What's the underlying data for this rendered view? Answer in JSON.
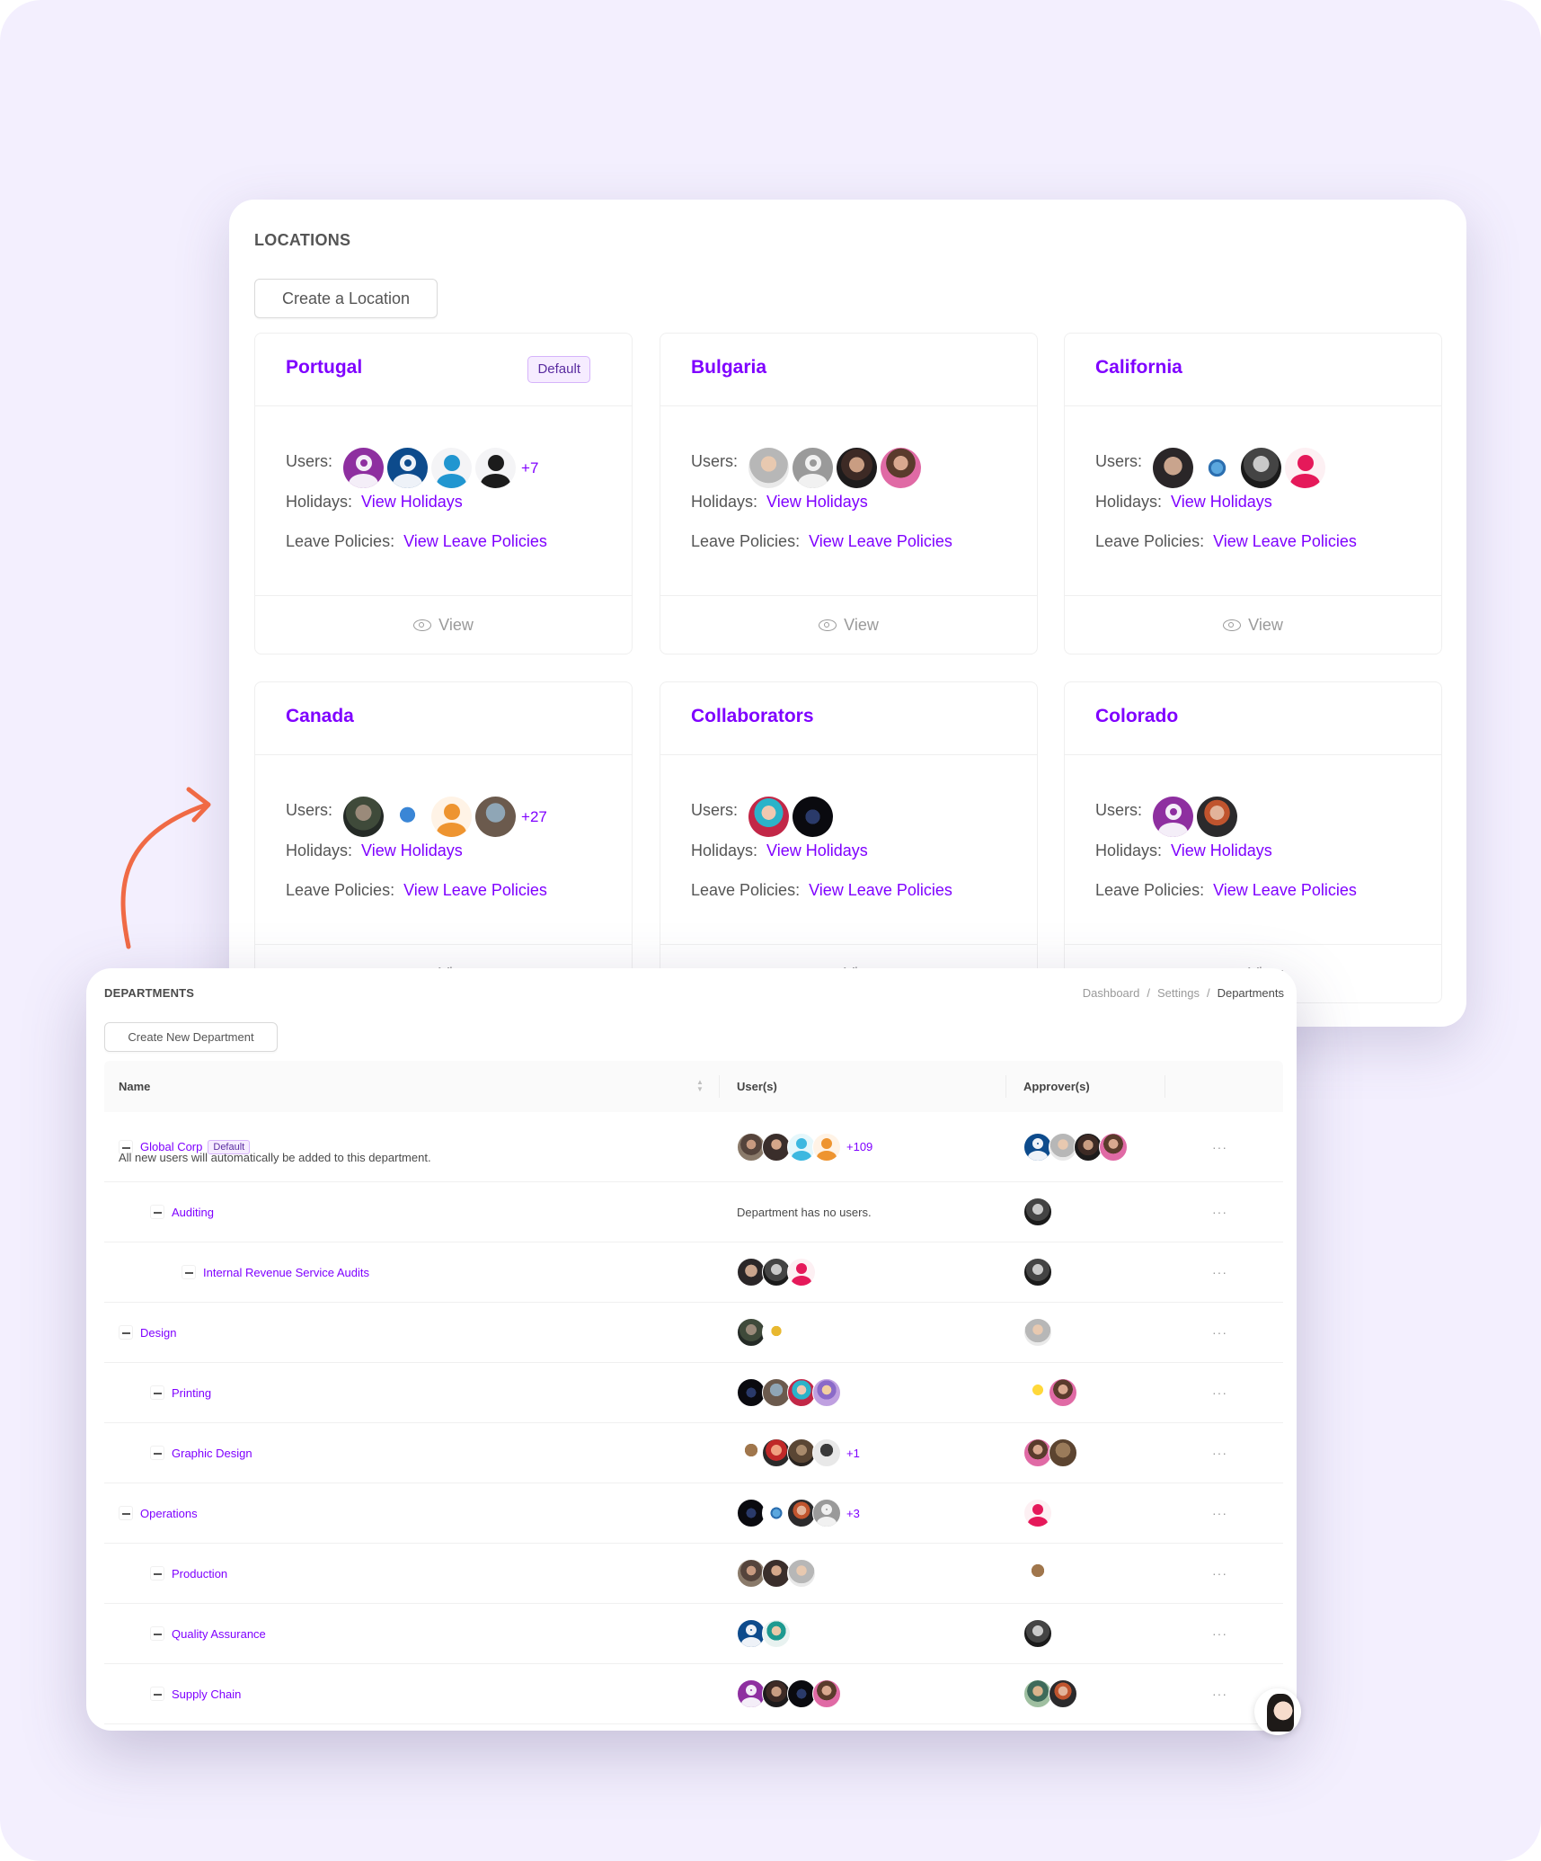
{
  "colors": {
    "accent": "#7f00ff",
    "background": "#f3effe",
    "arrow": "#f06a45"
  },
  "locations": {
    "title": "LOCATIONS",
    "create_label": "Create a Location",
    "labels": {
      "users": "Users",
      "holidays": "Holidays",
      "policies": "Leave Policies",
      "view_holidays": "View Holidays",
      "view_policies": "View Leave Policies",
      "view": "View",
      "default_tag": "Default"
    },
    "cards": [
      {
        "name": "Portugal",
        "is_default": true,
        "avatars": [
          "user-placeholder-purple",
          "user-placeholder-navy",
          "user-placeholder-blue",
          "user-placeholder-black"
        ],
        "more": "+7"
      },
      {
        "name": "Bulgaria",
        "is_default": false,
        "avatars": [
          "photo",
          "user-placeholder-gray",
          "photo",
          "photo"
        ],
        "more": ""
      },
      {
        "name": "California",
        "is_default": false,
        "avatars": [
          "photo",
          "smurf",
          "photo",
          "user-placeholder-pink"
        ],
        "more": ""
      },
      {
        "name": "Canada",
        "is_default": false,
        "avatars": [
          "photo",
          "stitch",
          "user-placeholder-orange",
          "photo"
        ],
        "more": "+27"
      },
      {
        "name": "Collaborators",
        "is_default": false,
        "avatars": [
          "photo",
          "photo"
        ],
        "more": ""
      },
      {
        "name": "Colorado",
        "is_default": false,
        "avatars": [
          "user-placeholder-purple",
          "photo"
        ],
        "more": ""
      }
    ]
  },
  "departments": {
    "title": "DEPARTMENTS",
    "breadcrumb": [
      "Dashboard",
      "Settings",
      "Departments"
    ],
    "create_label": "Create New Department",
    "columns": {
      "name": "Name",
      "users": "User(s)",
      "approvers": "Approver(s)"
    },
    "default_tag": "Default",
    "menu_glyph": "···",
    "rows": [
      {
        "name": "Global Corp",
        "level": 0,
        "is_default": true,
        "note": "All new users will automatically be added to this department.",
        "users_count": 4,
        "users_more": "+109",
        "approvers_count": 4,
        "empty_text": ""
      },
      {
        "name": "Auditing",
        "level": 1,
        "is_default": false,
        "note": "",
        "users_count": 0,
        "users_more": "",
        "approvers_count": 1,
        "empty_text": "Department has no users."
      },
      {
        "name": "Internal Revenue Service Audits",
        "level": 2,
        "is_default": false,
        "note": "",
        "users_count": 3,
        "users_more": "",
        "approvers_count": 1,
        "empty_text": ""
      },
      {
        "name": "Design",
        "level": 0,
        "is_default": false,
        "note": "",
        "users_count": 2,
        "users_more": "",
        "approvers_count": 1,
        "empty_text": ""
      },
      {
        "name": "Printing",
        "level": 1,
        "is_default": false,
        "note": "",
        "users_count": 4,
        "users_more": "",
        "approvers_count": 2,
        "empty_text": ""
      },
      {
        "name": "Graphic Design",
        "level": 1,
        "is_default": false,
        "note": "",
        "users_count": 4,
        "users_more": "+1",
        "approvers_count": 2,
        "empty_text": ""
      },
      {
        "name": "Operations",
        "level": 0,
        "is_default": false,
        "note": "",
        "users_count": 4,
        "users_more": "+3",
        "approvers_count": 1,
        "empty_text": ""
      },
      {
        "name": "Production",
        "level": 1,
        "is_default": false,
        "note": "",
        "users_count": 3,
        "users_more": "",
        "approvers_count": 1,
        "empty_text": ""
      },
      {
        "name": "Quality Assurance",
        "level": 1,
        "is_default": false,
        "note": "",
        "users_count": 2,
        "users_more": "",
        "approvers_count": 1,
        "empty_text": ""
      },
      {
        "name": "Supply Chain",
        "level": 1,
        "is_default": false,
        "note": "",
        "users_count": 4,
        "users_more": "",
        "approvers_count": 2,
        "empty_text": ""
      }
    ]
  }
}
